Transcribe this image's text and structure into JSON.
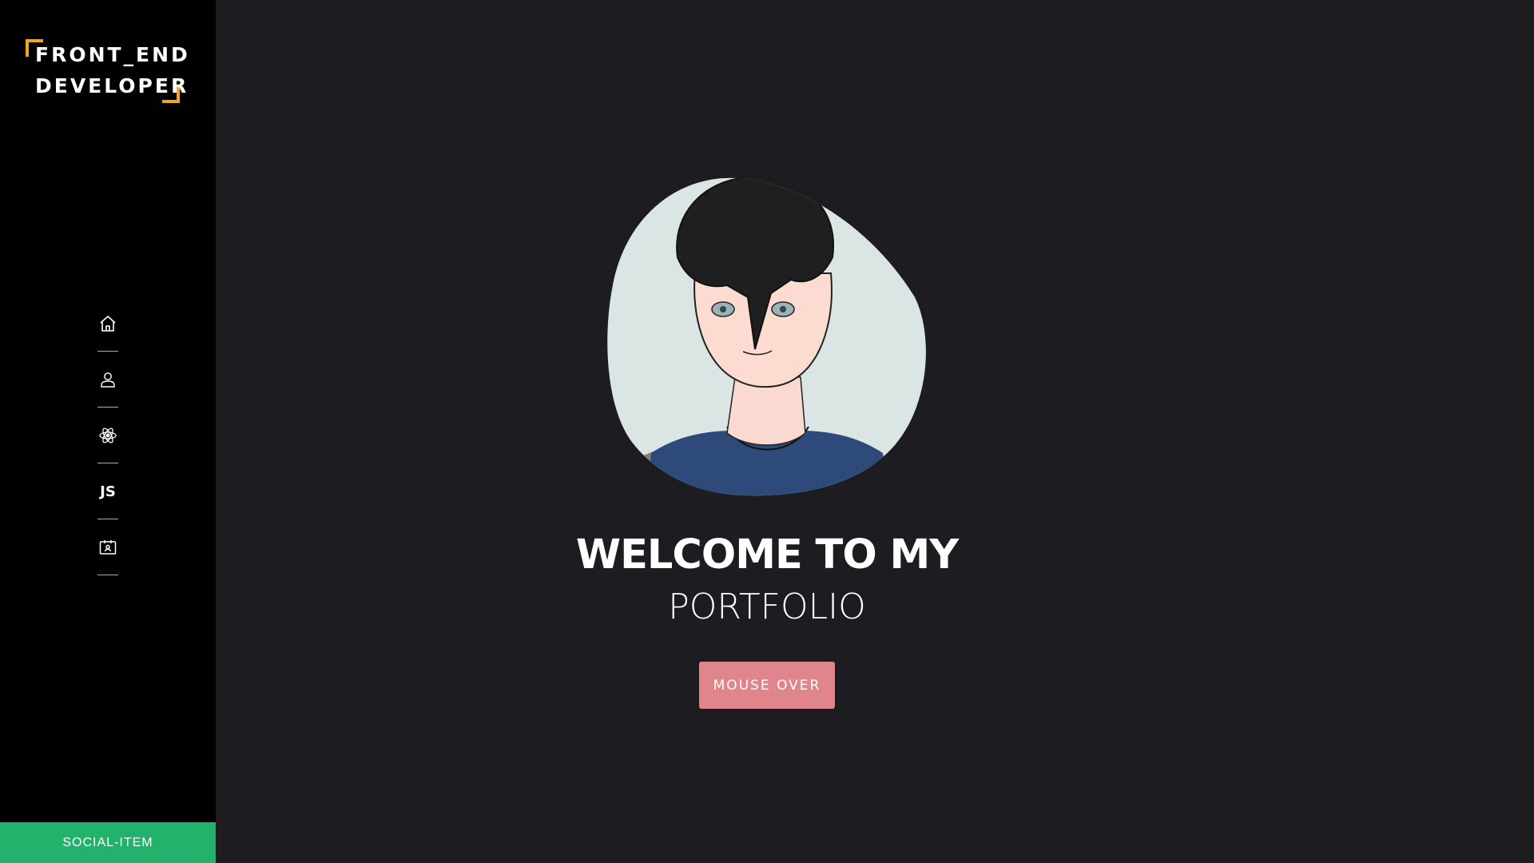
{
  "sidebar": {
    "logo": {
      "line1": "FRONT_END",
      "line2": "DEVELOPER",
      "accent_color": "#f3a51d"
    },
    "nav": [
      {
        "icon": "home-icon"
      },
      {
        "icon": "user-icon"
      },
      {
        "icon": "react-atom-icon"
      },
      {
        "icon": "js-icon",
        "label": "JS"
      },
      {
        "icon": "contact-card-icon"
      }
    ],
    "social": {
      "label": "SOCIAL-ITEM",
      "color": "#22b26b"
    }
  },
  "main": {
    "headline": "WELCOME TO MY",
    "subline": "PORTFOLIO",
    "button_label": "MOUSE OVER",
    "button_color": "#e0858c",
    "background_color": "#1d1c21"
  }
}
